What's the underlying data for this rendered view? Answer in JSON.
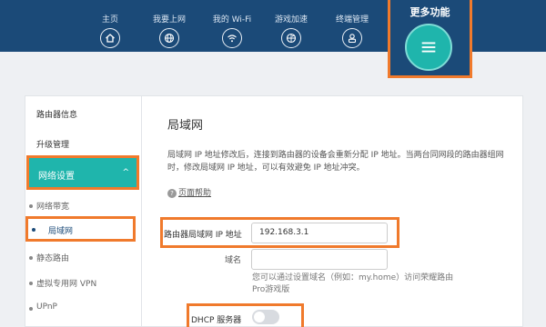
{
  "nav": {
    "items": [
      {
        "label": "主页",
        "icon": "home-icon"
      },
      {
        "label": "我要上网",
        "icon": "globe-icon"
      },
      {
        "label": "我的 Wi-Fi",
        "icon": "wifi-icon"
      },
      {
        "label": "游戏加速",
        "icon": "game-accel-icon"
      },
      {
        "label": "终端管理",
        "icon": "user-icon"
      }
    ],
    "more": {
      "label": "更多功能",
      "icon": "menu-icon"
    }
  },
  "sidebar": {
    "top_items": [
      "路由器信息",
      "升级管理"
    ],
    "active_group": {
      "label": "网络设置",
      "chevron": "^"
    },
    "sub_items": [
      "网络带宽",
      "局域网",
      "静态路由",
      "虚拟专用网 VPN",
      "UPnP"
    ],
    "active_sub_index": 1
  },
  "main": {
    "title": "局域网",
    "description": "局域网 IP 地址修改后，连接到路由器的设备会重新分配 IP 地址。当两台同网段的路由器组网时，修改局域网 IP 地址，可以有效避免 IP 地址冲突。",
    "help": {
      "icon_text": "?",
      "label": "页面帮助"
    },
    "ip": {
      "label": "路由器局域网 IP 地址",
      "value": "192.168.3.1"
    },
    "domain": {
      "label": "域名",
      "value": "",
      "hint": "您可以通过设置域名（例如：my.home）访问荣耀路由Pro游戏版"
    },
    "dhcp": {
      "label": "DHCP 服务器",
      "enabled": false
    }
  },
  "colors": {
    "nav_bg": "#1b4a78",
    "accent": "#1fb5ac",
    "highlight": "#f07a2c"
  }
}
